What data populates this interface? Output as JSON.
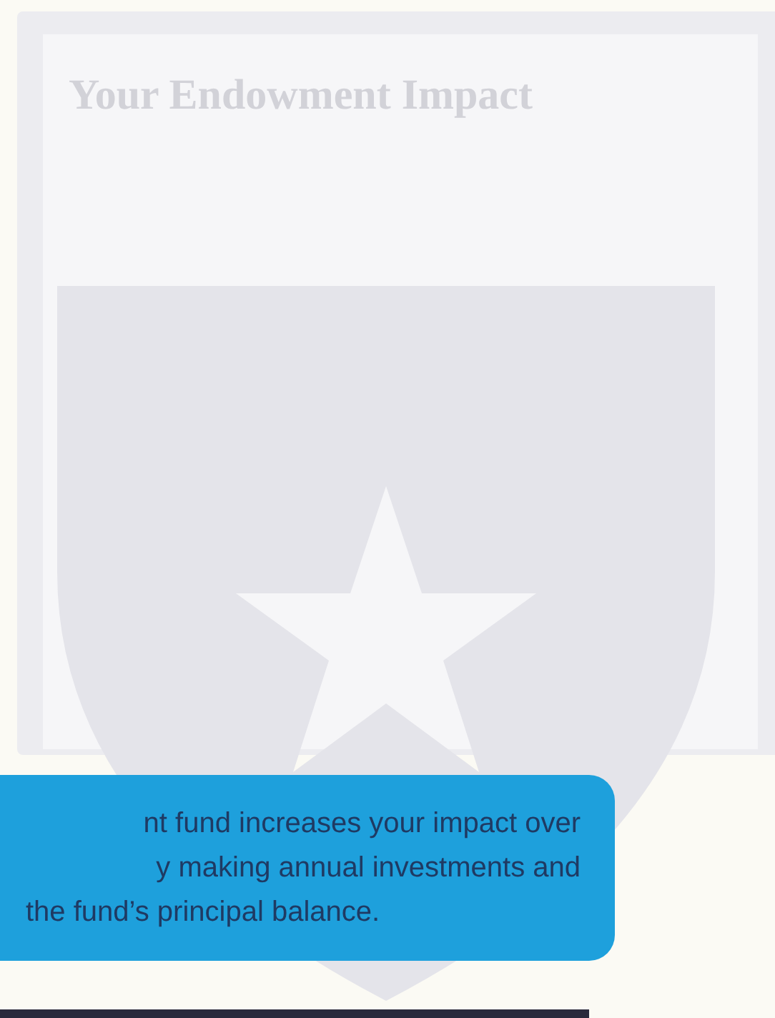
{
  "heading": "Your Endowment Impact",
  "callout": {
    "lines": [
      "nt fund increases your impact over",
      "y making annual investments and",
      "the fund’s principal balance."
    ]
  }
}
